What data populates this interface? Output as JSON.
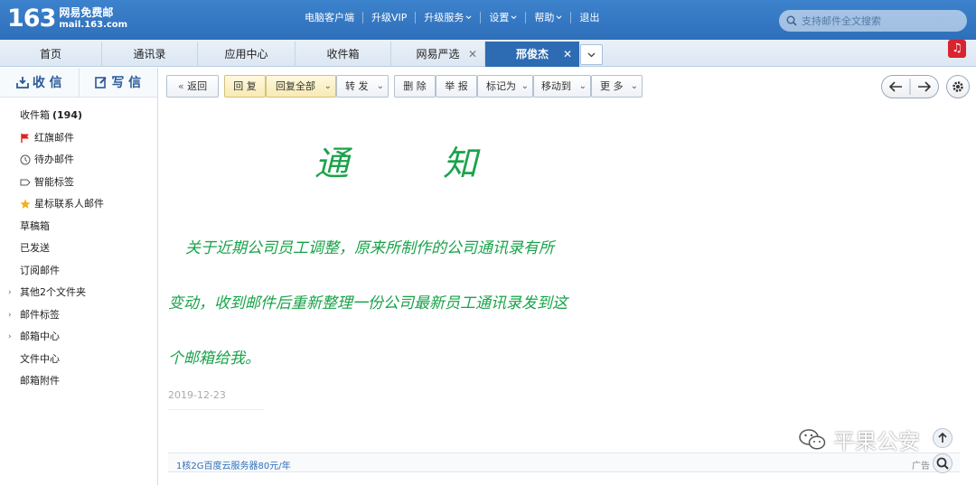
{
  "header": {
    "logo_num": "163",
    "logo_cn": "网易免费邮",
    "logo_url": "mail.163.com",
    "nav": [
      "电脑客户端",
      "升级VIP",
      "升级服务",
      "设置",
      "帮助",
      "退出"
    ],
    "search_placeholder": "支持邮件全文搜索"
  },
  "tabs": [
    "首页",
    "通讯录",
    "应用中心",
    "收件箱",
    "网易严选",
    "邢俊杰"
  ],
  "sidebar": {
    "receive": "收 信",
    "compose": "写 信",
    "inbox_label": "收件箱",
    "inbox_count": "(194)",
    "folders": [
      "红旗邮件",
      "待办邮件",
      "智能标签",
      "星标联系人邮件",
      "草稿箱",
      "已发送",
      "订阅邮件",
      "其他2个文件夹",
      "邮件标签",
      "邮箱中心",
      "文件中心",
      "邮箱附件"
    ]
  },
  "toolbar": {
    "back": "返回",
    "reply": "回 复",
    "reply_all": "回复全部",
    "forward": "转 发",
    "delete": "删 除",
    "report": "举 报",
    "mark_as": "标记为",
    "move_to": "移动到",
    "more": "更 多"
  },
  "mail": {
    "title_1": "通",
    "title_2": "知",
    "line_1": "关于近期公司员工调整，原来所制作的公司通讯录有所",
    "line_2": "变动，收到邮件后重新整理一份公司最新员工通讯录发到这",
    "line_3": "个邮箱给我。",
    "date": "2019-12-23"
  },
  "ad": {
    "link": "1核2G百度云服务器80元/年",
    "tag": "广告"
  },
  "watermark": "平果公安",
  "colors": {
    "header": "#2e6fba",
    "active_tab": "#2d6cb3",
    "mail_text": "#1aa34a"
  }
}
